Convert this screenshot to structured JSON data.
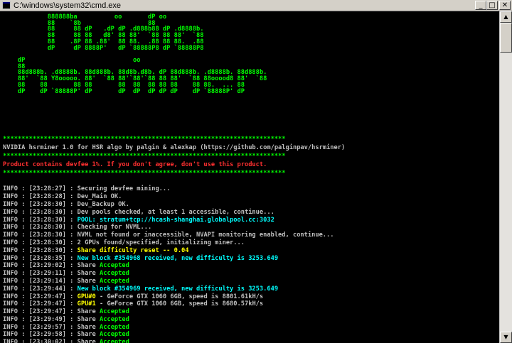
{
  "window": {
    "title": "C:\\windows\\system32\\cmd.exe",
    "min_glyph": "_",
    "max_glyph": "□",
    "close_glyph": "✕"
  },
  "banner": {
    "logo_lines": [
      "            888888ba          oo       dP oo",
      "            88    `8b                  88",
      "            88     88 dP   .dP dP .d888b88 dP .d8888b.",
      "            88     88 88   d8' 88 88'  `88 88 88'  `88",
      "            88    .8P 88 .88'  88 88.  .88 88 88.  .88",
      "            dP     dP 8888P'   dP `88888P8 dP `88888P8",
      "",
      "    dP                             oo",
      "    88",
      "    88d888b. .d8888b. 88d888b. 88d8b.d8b. dP 88d888b. .d8888b. 88d888b.",
      "    88'  `88 Y8ooooo. 88'  `88 88'`88'`88 88 88'  `88 88ooood8 88'  `88",
      "    88    88       88 88       88  88  88 88 88    88 88.  ... 88",
      "    dP    dP `88888P' dP       dP  dP  dP dP dP    dP `88888P' dP"
    ],
    "separator": "****************************************************************************",
    "info": "NVIDIA hsrminer 1.0 for HSR algo by palgin & alexkap (https://github.com/palginpav/hsrminer)",
    "devfee_warning": "Product contains devfee 1%. If you don't agree, don't use this product."
  },
  "log": [
    {
      "prefix": "INFO : [23:28:27] : ",
      "text": "Securing devfee mining...",
      "accent": "",
      "tail": ""
    },
    {
      "prefix": "INFO : [23:28:28] : ",
      "text": "Dev_Main OK.",
      "accent": "",
      "tail": ""
    },
    {
      "prefix": "INFO : [23:28:30] : ",
      "text": "Dev_Backup OK.",
      "accent": "",
      "tail": ""
    },
    {
      "prefix": "INFO : [23:28:30] : ",
      "text": "Dev pools checked, at least 1 accessible, continue...",
      "accent": "",
      "tail": ""
    },
    {
      "prefix": "INFO : [23:28:30] : ",
      "text": "",
      "accent": "POOL: stratum+tcp://hcash-shanghai.globalpool.cc:3032",
      "accent_color": "cyan",
      "tail": ""
    },
    {
      "prefix": "INFO : [23:28:30] : ",
      "text": "Checking for NVML...",
      "accent": "",
      "tail": ""
    },
    {
      "prefix": "INFO : [23:28:30] : ",
      "text": "NVML not found or inaccessible, NVAPI monitoring enabled, continue...",
      "accent": "",
      "tail": ""
    },
    {
      "prefix": "INFO : [23:28:30] : ",
      "text": "2 GPUs found/specified, initializing miner...",
      "accent": "",
      "tail": ""
    },
    {
      "prefix": "INFO : [23:28:30] : ",
      "text": "",
      "accent": "Share difficulty reset -- 0.04",
      "accent_color": "yellow",
      "tail": ""
    },
    {
      "prefix": "INFO : [23:28:35] : ",
      "text": "",
      "accent": "New block #354968 received, new difficulty is 3253.649",
      "accent_color": "cyan",
      "tail": ""
    },
    {
      "prefix": "INFO : [23:29:02] : ",
      "text": "Share ",
      "accent": "Accepted",
      "accent_color": "green",
      "tail": ""
    },
    {
      "prefix": "INFO : [23:29:11] : ",
      "text": "Share ",
      "accent": "Accepted",
      "accent_color": "green",
      "tail": ""
    },
    {
      "prefix": "INFO : [23:29:14] : ",
      "text": "Share ",
      "accent": "Accepted",
      "accent_color": "green",
      "tail": ""
    },
    {
      "prefix": "INFO : [23:29:44] : ",
      "text": "",
      "accent": "New block #354969 received, new difficulty is 3253.649",
      "accent_color": "cyan",
      "tail": ""
    },
    {
      "prefix": "INFO : [23:29:47] : ",
      "text": "",
      "accent": "GPU#0",
      "accent_color": "yellow",
      "tail": " - GeForce GTX 1060 6GB, speed is 8801.61kH/s"
    },
    {
      "prefix": "INFO : [23:29:47] : ",
      "text": "",
      "accent": "GPU#1",
      "accent_color": "yellow",
      "tail": " - GeForce GTX 1060 6GB, speed is 8680.57kH/s"
    },
    {
      "prefix": "INFO : [23:29:47] : ",
      "text": "Share ",
      "accent": "Accepted",
      "accent_color": "green",
      "tail": ""
    },
    {
      "prefix": "INFO : [23:29:49] : ",
      "text": "Share ",
      "accent": "Accepted",
      "accent_color": "green",
      "tail": ""
    },
    {
      "prefix": "INFO : [23:29:57] : ",
      "text": "Share ",
      "accent": "Accepted",
      "accent_color": "green",
      "tail": ""
    },
    {
      "prefix": "INFO : [23:29:58] : ",
      "text": "Share ",
      "accent": "Accepted",
      "accent_color": "green",
      "tail": ""
    },
    {
      "prefix": "INFO : [23:30:02] : ",
      "text": "Share ",
      "accent": "Accepted",
      "accent_color": "green",
      "tail": ""
    }
  ],
  "colors": {
    "background": "#000000",
    "green": "#00ff00",
    "gray": "#c0c0c0",
    "red": "#ff3030",
    "cyan": "#00ffff",
    "yellow": "#ffff00"
  },
  "icons": {
    "window_icon": "cmd-icon",
    "scroll_up": "▲",
    "scroll_down": "▼"
  }
}
